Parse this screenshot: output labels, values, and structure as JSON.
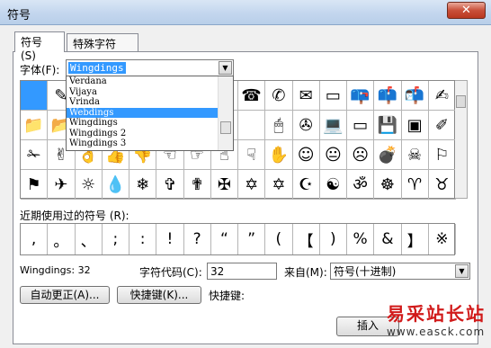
{
  "window": {
    "title": "符号",
    "close": "✕"
  },
  "tabs": [
    "符号 (S)",
    "特殊字符 (P)"
  ],
  "font": {
    "label": "字体(F):",
    "value": "Wingdings"
  },
  "dropdown": [
    "Verdana",
    "Vijaya",
    "Vrinda",
    "Webdings",
    "Wingdings",
    "Wingdings 2",
    "Wingdings 3"
  ],
  "grid": {
    "rows": [
      [
        "",
        "✎",
        "",
        "",
        "",
        "",
        "",
        "",
        "☎",
        "✆",
        "✉",
        "▭",
        "📪",
        "📫",
        "📬",
        "✍"
      ],
      [
        "📁",
        "📂",
        "",
        "",
        "",
        "",
        "",
        "",
        "",
        "🖱",
        "✇",
        "💻",
        "▭",
        "💾",
        "▣",
        "✐"
      ],
      [
        "✁",
        "✌",
        "👌",
        "👍",
        "👎",
        "☜",
        "☞",
        "☝",
        "☟",
        "✋",
        "☺",
        "😐",
        "☹",
        "💣",
        "☠",
        "⚐"
      ],
      [
        "⚑",
        "✈",
        "☼",
        "💧",
        "❄",
        "✞",
        "✟",
        "✠",
        "✡",
        "✡",
        "☪",
        "☯",
        "ॐ",
        "☸",
        "♈",
        "♉"
      ]
    ]
  },
  "recent": {
    "label": "近期使用过的符号 (R):",
    "symbols": [
      ",",
      "。",
      "、",
      ";",
      ":",
      "!",
      "?",
      "“",
      "”",
      "(",
      "【",
      ")",
      "%",
      "&",
      "】",
      "※"
    ]
  },
  "status": {
    "name": "Wingdings: 32",
    "char_code_label": "字符代码(C):",
    "char_code_value": "32",
    "from_label": "来自(M):",
    "from_value": "符号(十进制)"
  },
  "buttons": {
    "autocorrect": "自动更正(A)...",
    "shortcut_key": "快捷键(K)...",
    "shortcut_label": "快捷键:",
    "insert": "插入"
  },
  "watermark": {
    "brand": "易采站长站",
    "url": "www.easck.com"
  }
}
